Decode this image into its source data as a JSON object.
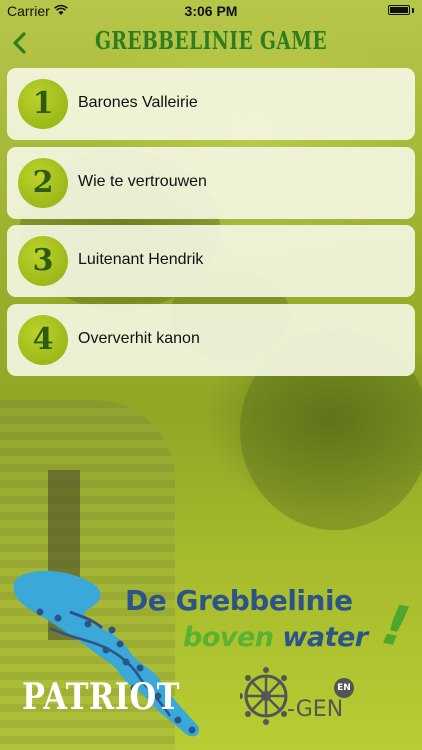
{
  "status_bar": {
    "carrier": "Carrier",
    "time": "3:06 PM",
    "icons": [
      "wifi-icon",
      "battery-icon"
    ]
  },
  "nav": {
    "title": "GREBBELINIE GAME",
    "back_icon": "chevron-left-icon"
  },
  "chapters": [
    {
      "number": "1",
      "title": "Barones Valleirie"
    },
    {
      "number": "2",
      "title": "Wie te vertrouwen"
    },
    {
      "number": "3",
      "title": "Luitenant Hendrik"
    },
    {
      "number": "4",
      "title": "Oververhit kanon"
    }
  ],
  "footer": {
    "patriot": "PATRIOT",
    "grebbe_line1": "De Grebbelinie",
    "grebbe_boven": "boven",
    "grebbe_water": "water",
    "grebbe_exclaim": "!",
    "ogen_text": "-GEN",
    "language_badge": "EN"
  },
  "colors": {
    "title_green": "#2f7d1e",
    "number_circle": "#a8c21f",
    "map_blue": "#3aa8d8",
    "grebbe_blue": "#2d5489",
    "grebbe_green": "#5ab232"
  }
}
